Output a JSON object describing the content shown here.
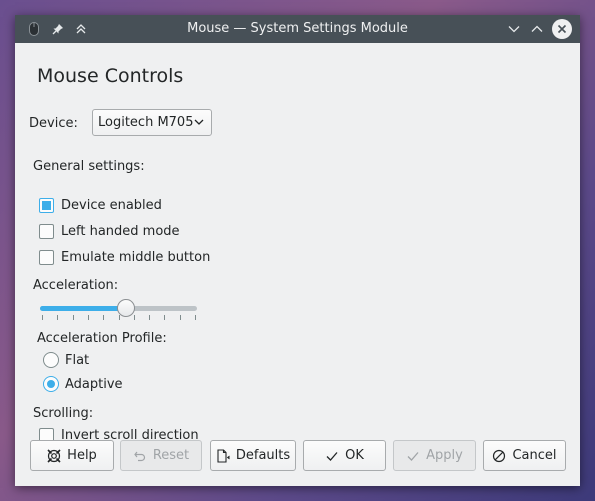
{
  "window": {
    "title": "Mouse — System Settings Module"
  },
  "page": {
    "heading": "Mouse Controls"
  },
  "device": {
    "label": "Device:",
    "selected": "Logitech M705"
  },
  "general": {
    "label": "General settings:",
    "options": [
      {
        "label": "Device enabled",
        "checked": true
      },
      {
        "label": "Left handed mode",
        "checked": false
      },
      {
        "label": "Emulate middle button",
        "checked": false
      }
    ]
  },
  "acceleration": {
    "label": "Acceleration:",
    "value_fraction": 0.55,
    "ticks": 11
  },
  "profile": {
    "label": "Acceleration Profile:",
    "options": [
      {
        "label": "Flat",
        "selected": false
      },
      {
        "label": "Adaptive",
        "selected": true
      }
    ]
  },
  "scrolling": {
    "label": "Scrolling:",
    "options": [
      {
        "label": "Invert scroll direction",
        "checked": false
      }
    ]
  },
  "buttons": {
    "help": "Help",
    "reset": "Reset",
    "defaults": "Defaults",
    "ok": "OK",
    "apply": "Apply",
    "cancel": "Cancel"
  },
  "colors": {
    "accent": "#3daee9",
    "titlebar": "#475057",
    "window_bg": "#eff0f1"
  }
}
